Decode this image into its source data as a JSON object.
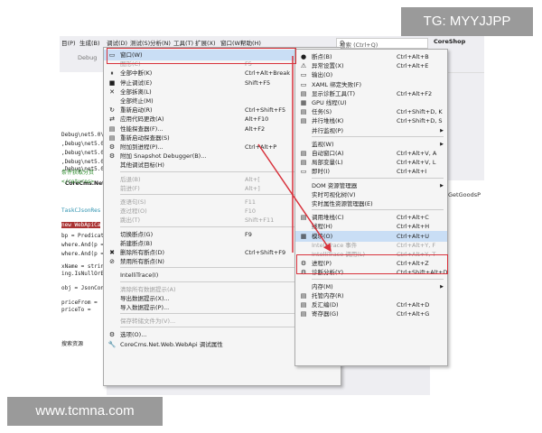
{
  "watermark": {
    "top": "TG: MYYJJPP",
    "bottom": "www.tcmna.com"
  },
  "menubar": {
    "items": [
      "目(P)",
      "生成(B)",
      "调试(D)",
      "测试(S)",
      "分析(N)",
      "工具(T)",
      "扩展(X)",
      "窗口(W)",
      "帮助(H)"
    ],
    "search_placeholder": "搜索 (Ctrl+Q)",
    "project": "CoreShop"
  },
  "toolbar": {
    "config": "Debug"
  },
  "editor": {
    "output_lines": [
      "Debug\\net5.0\\A",
      ",Debug\\net5.0\\A",
      ",Debug\\net5.0\\A",
      ",Debug\\net5.0\\A",
      ",Debug\\net5.0\\A"
    ],
    "file_tab": "CoreCms.Net",
    "right_tab": "GetGoodsP",
    "code": [
      "条件获取分页",
      "</returns>",
      "TaskCJsonRes",
      "new WebApiCa",
      "bp = Predicate",
      "where.And(p =",
      "where.And(p =",
      "xName = strin",
      "ing.IsNullOrE",
      "obj = JsonCon",
      "priceFrom = ",
      "priceTo = ",
      " 搜索资源"
    ]
  },
  "debug_menu": [
    {
      "icon": "▭",
      "label": "窗口(W)",
      "shortcut": "",
      "arrow": true,
      "disabled": false,
      "highlight": true
    },
    {
      "icon": "",
      "label": "图形(C)",
      "shortcut": "F5",
      "arrow": false,
      "disabled": true
    },
    {
      "icon": "⏸",
      "label": "全部中断(K)",
      "shortcut": "Ctrl+Alt+Break",
      "arrow": false,
      "disabled": false
    },
    {
      "icon": "■",
      "label": "停止调试(E)",
      "shortcut": "Shift+F5",
      "arrow": false,
      "disabled": false
    },
    {
      "icon": "✕",
      "label": "全部拆离(L)",
      "shortcut": "",
      "arrow": false,
      "disabled": false
    },
    {
      "icon": "",
      "label": "全部终止(M)",
      "shortcut": "",
      "arrow": false,
      "disabled": false
    },
    {
      "icon": "↻",
      "label": "重新启动(R)",
      "shortcut": "Ctrl+Shift+F5",
      "arrow": false,
      "disabled": false
    },
    {
      "icon": "⇄",
      "label": "应用代码更改(A)",
      "shortcut": "Alt+F10",
      "arrow": false,
      "disabled": false
    },
    {
      "icon": "▤",
      "label": "性能探查器(F)...",
      "shortcut": "Alt+F2",
      "arrow": false,
      "disabled": false
    },
    {
      "icon": "▤",
      "label": "重新启动探查器(S)",
      "shortcut": "",
      "arrow": false,
      "disabled": false
    },
    {
      "icon": "⚙",
      "label": "附加到进程(P)...",
      "shortcut": "Ctrl+Alt+P",
      "arrow": false,
      "disabled": false
    },
    {
      "icon": "⚙",
      "label": "附加 Snapshot Debugger(B)...",
      "shortcut": "",
      "arrow": false,
      "disabled": false
    },
    {
      "icon": "",
      "label": "其他调试目标(H)",
      "shortcut": "",
      "arrow": true,
      "disabled": false
    },
    {
      "sep": true
    },
    {
      "icon": "",
      "label": "后退(B)",
      "shortcut": "Alt+[",
      "arrow": false,
      "disabled": true
    },
    {
      "icon": "",
      "label": "前进(F)",
      "shortcut": "Alt+]",
      "arrow": false,
      "disabled": true
    },
    {
      "sep": true
    },
    {
      "icon": "",
      "label": "逐语句(S)",
      "shortcut": "F11",
      "arrow": false,
      "disabled": true
    },
    {
      "icon": "",
      "label": "逐过程(O)",
      "shortcut": "F10",
      "arrow": false,
      "disabled": true
    },
    {
      "icon": "",
      "label": "跳出(T)",
      "shortcut": "Shift+F11",
      "arrow": false,
      "disabled": true
    },
    {
      "sep": true
    },
    {
      "icon": "",
      "label": "切换断点(G)",
      "shortcut": "F9",
      "arrow": false,
      "disabled": false
    },
    {
      "icon": "",
      "label": "新建断点(B)",
      "shortcut": "",
      "arrow": true,
      "disabled": false
    },
    {
      "icon": "✖",
      "label": "删除所有断点(D)",
      "shortcut": "Ctrl+Shift+F9",
      "arrow": false,
      "disabled": false
    },
    {
      "icon": "⊘",
      "label": "禁用所有断点(N)",
      "shortcut": "",
      "arrow": false,
      "disabled": false
    },
    {
      "sep": true
    },
    {
      "icon": "",
      "label": "IntelliTrace(I)",
      "shortcut": "",
      "arrow": true,
      "disabled": false
    },
    {
      "sep": true
    },
    {
      "icon": "",
      "label": "清除所有数据提示(A)",
      "shortcut": "",
      "arrow": false,
      "disabled": true
    },
    {
      "icon": "",
      "label": "导出数据提示(X)...",
      "shortcut": "",
      "arrow": false,
      "disabled": false
    },
    {
      "icon": "",
      "label": "导入数据提示(P)...",
      "shortcut": "",
      "arrow": false,
      "disabled": false
    },
    {
      "sep": true
    },
    {
      "icon": "",
      "label": "保存转储文件为(V)...",
      "shortcut": "",
      "arrow": false,
      "disabled": true
    },
    {
      "sep": true
    },
    {
      "icon": "⚙",
      "label": "选项(O)...",
      "shortcut": "",
      "arrow": false,
      "disabled": false
    },
    {
      "icon": "🔧",
      "label": "CoreCms.Net.Web.WebApi 调试属性",
      "shortcut": "",
      "arrow": false,
      "disabled": false
    }
  ],
  "window_menu": [
    {
      "icon": "●",
      "label": "断点(B)",
      "shortcut": "Ctrl+Alt+B",
      "arrow": false,
      "disabled": false
    },
    {
      "icon": "⚠",
      "label": "异常设置(X)",
      "shortcut": "Ctrl+Alt+E",
      "arrow": false,
      "disabled": false
    },
    {
      "icon": "▭",
      "label": "输出(O)",
      "shortcut": "",
      "arrow": false,
      "disabled": false
    },
    {
      "icon": "▭",
      "label": "XAML 绑定失败(F)",
      "shortcut": "",
      "arrow": false,
      "disabled": false
    },
    {
      "icon": "▤",
      "label": "显示诊断工具(T)",
      "shortcut": "Ctrl+Alt+F2",
      "arrow": false,
      "disabled": false
    },
    {
      "icon": "▦",
      "label": "GPU 线程(U)",
      "shortcut": "",
      "arrow": false,
      "disabled": false
    },
    {
      "icon": "▤",
      "label": "任务(S)",
      "shortcut": "Ctrl+Shift+D, K",
      "arrow": false,
      "disabled": false
    },
    {
      "icon": "▤",
      "label": "并行堆栈(K)",
      "shortcut": "Ctrl+Shift+D, S",
      "arrow": false,
      "disabled": false
    },
    {
      "icon": "",
      "label": "并行监视(P)",
      "shortcut": "",
      "arrow": true,
      "disabled": false
    },
    {
      "sep": true
    },
    {
      "icon": "",
      "label": "监视(W)",
      "shortcut": "",
      "arrow": true,
      "disabled": false
    },
    {
      "icon": "▤",
      "label": "自动窗口(A)",
      "shortcut": "Ctrl+Alt+V, A",
      "arrow": false,
      "disabled": false
    },
    {
      "icon": "▤",
      "label": "局部变量(L)",
      "shortcut": "Ctrl+Alt+V, L",
      "arrow": false,
      "disabled": false
    },
    {
      "icon": "▭",
      "label": "即时(I)",
      "shortcut": "Ctrl+Alt+I",
      "arrow": false,
      "disabled": false
    },
    {
      "sep": true
    },
    {
      "icon": "",
      "label": "DOM 资源管理器",
      "shortcut": "",
      "arrow": true,
      "disabled": false
    },
    {
      "icon": "",
      "label": "实时可视化树(V)",
      "shortcut": "",
      "arrow": false,
      "disabled": false
    },
    {
      "icon": "",
      "label": "实时属性资源管理器(E)",
      "shortcut": "",
      "arrow": false,
      "disabled": false
    },
    {
      "sep": true
    },
    {
      "icon": "▤",
      "label": "调用堆栈(C)",
      "shortcut": "Ctrl+Alt+C",
      "arrow": false,
      "disabled": false
    },
    {
      "icon": "",
      "label": "线程(H)",
      "shortcut": "Ctrl+Alt+H",
      "arrow": false,
      "disabled": false
    },
    {
      "icon": "▦",
      "label": "模块(O)",
      "shortcut": "Ctrl+Alt+U",
      "arrow": false,
      "disabled": false,
      "highlight": true
    },
    {
      "icon": "",
      "label": "IntelliTrace 事件",
      "shortcut": "Ctrl+Alt+Y, F",
      "arrow": false,
      "disabled": true
    },
    {
      "icon": "",
      "label": "IntelliTrace 调用(L)",
      "shortcut": "Ctrl+Alt+Y, T",
      "arrow": false,
      "disabled": true
    },
    {
      "icon": "⚙",
      "label": "进程(P)",
      "shortcut": "Ctrl+Alt+Z",
      "arrow": false,
      "disabled": false
    },
    {
      "icon": "⚙",
      "label": "诊断分析(Y)",
      "shortcut": "Ctrl+Shift+Alt+D",
      "arrow": false,
      "disabled": false
    },
    {
      "sep": true
    },
    {
      "icon": "",
      "label": "内存(M)",
      "shortcut": "",
      "arrow": true,
      "disabled": false
    },
    {
      "icon": "▤",
      "label": "托管内存(R)",
      "shortcut": "",
      "arrow": false,
      "disabled": false
    },
    {
      "icon": "▤",
      "label": "反汇编(D)",
      "shortcut": "Ctrl+Alt+D",
      "arrow": false,
      "disabled": false
    },
    {
      "icon": "▤",
      "label": "寄存器(G)",
      "shortcut": "Ctrl+Alt+G",
      "arrow": false,
      "disabled": false
    }
  ]
}
